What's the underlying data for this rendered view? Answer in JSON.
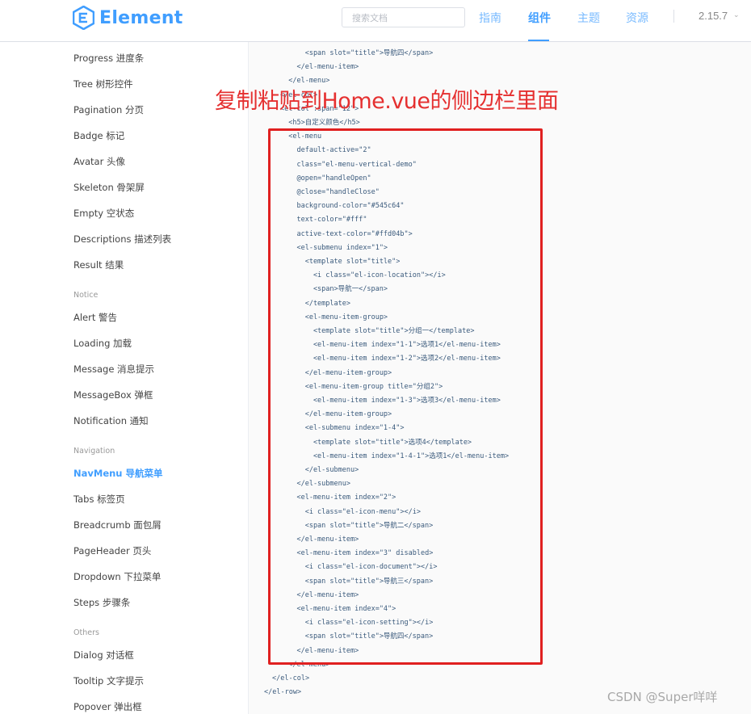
{
  "header": {
    "logo_text": "Element",
    "search_placeholder": "搜索文档",
    "nav": [
      "指南",
      "组件",
      "主题",
      "资源"
    ],
    "active_nav": "组件",
    "version": "2.15.7"
  },
  "sidebar": {
    "items_top": [
      "Progress 进度条",
      "Tree 树形控件",
      "Pagination 分页",
      "Badge 标记",
      "Avatar 头像",
      "Skeleton 骨架屏",
      "Empty 空状态",
      "Descriptions 描述列表",
      "Result 结果"
    ],
    "group_notice": "Notice",
    "items_notice": [
      "Alert 警告",
      "Loading 加载",
      "Message 消息提示",
      "MessageBox 弹框",
      "Notification 通知"
    ],
    "group_navigation": "Navigation",
    "items_navigation": [
      "NavMenu 导航菜单",
      "Tabs 标签页",
      "Breadcrumb 面包屑",
      "PageHeader 页头",
      "Dropdown 下拉菜单",
      "Steps 步骤条"
    ],
    "group_others": "Others",
    "items_others": [
      "Dialog 对话框",
      "Tooltip 文字提示",
      "Popover 弹出框"
    ],
    "active_item": "NavMenu 导航菜单"
  },
  "code": {
    "lines": [
      "      <span slot=\"title\">导航四</span>",
      "    </el-menu-item>",
      "  </el-menu>",
      "</el-col>",
      "<el-col :span=\"12\">",
      "  <h5>自定义颜色</h5>",
      "  <el-menu",
      "    default-active=\"2\"",
      "    class=\"el-menu-vertical-demo\"",
      "    @open=\"handleOpen\"",
      "    @close=\"handleClose\"",
      "    background-color=\"#545c64\"",
      "    text-color=\"#fff\"",
      "    active-text-color=\"#ffd04b\">",
      "    <el-submenu index=\"1\">",
      "      <template slot=\"title\">",
      "        <i class=\"el-icon-location\"></i>",
      "        <span>导航一</span>",
      "      </template>",
      "      <el-menu-item-group>",
      "        <template slot=\"title\">分组一</template>",
      "        <el-menu-item index=\"1-1\">选项1</el-menu-item>",
      "        <el-menu-item index=\"1-2\">选项2</el-menu-item>",
      "      </el-menu-item-group>",
      "      <el-menu-item-group title=\"分组2\">",
      "        <el-menu-item index=\"1-3\">选项3</el-menu-item>",
      "      </el-menu-item-group>",
      "      <el-submenu index=\"1-4\">",
      "        <template slot=\"title\">选项4</template>",
      "        <el-menu-item index=\"1-4-1\">选项1</el-menu-item>",
      "      </el-submenu>",
      "    </el-submenu>",
      "    <el-menu-item index=\"2\">",
      "      <i class=\"el-icon-menu\"></i>",
      "      <span slot=\"title\">导航二</span>",
      "    </el-menu-item>",
      "    <el-menu-item index=\"3\" disabled>",
      "      <i class=\"el-icon-document\"></i>",
      "      <span slot=\"title\">导航三</span>",
      "    </el-menu-item>",
      "    <el-menu-item index=\"4\">",
      "      <i class=\"el-icon-setting\"></i>",
      "      <span slot=\"title\">导航四</span>",
      "    </el-menu-item>",
      "  </el-menu>",
      "</el-col>",
      "</el-row>"
    ]
  },
  "annotation": {
    "overlay_text": "复制粘贴到Home.vue的侧边栏里面",
    "watermark": "CSDN @Super咩咩"
  },
  "colors": {
    "accent": "#409eff",
    "highlight": "#e02020"
  }
}
